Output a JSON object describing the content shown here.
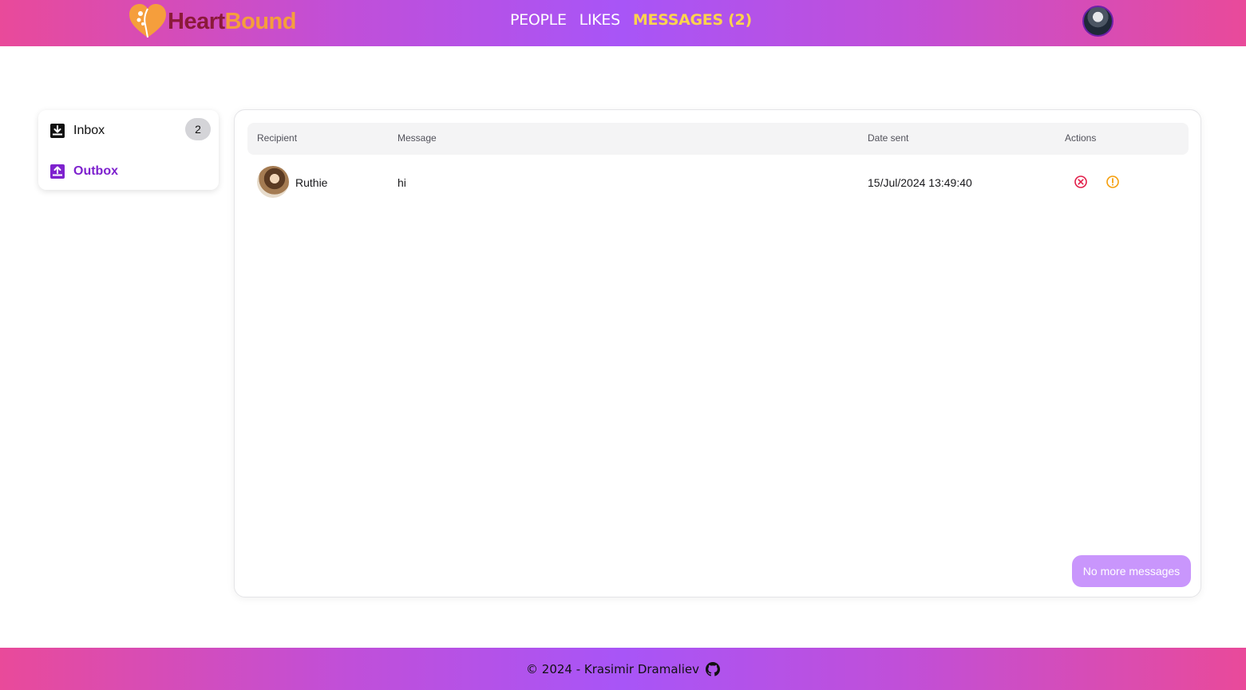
{
  "brand": {
    "part1": "Heart",
    "part2": "Bound",
    "icon": "heart-logo-icon"
  },
  "nav": {
    "links": [
      {
        "label": "PEOPLE"
      },
      {
        "label": "LIKES"
      },
      {
        "label": "MESSAGES (2)",
        "active": true
      }
    ],
    "avatar_icon": "user-avatar"
  },
  "sidebar": {
    "inbox": {
      "label": "Inbox",
      "count": "2",
      "icon": "inbox-down-icon"
    },
    "outbox": {
      "label": "Outbox",
      "icon": "outbox-up-icon",
      "active": true
    }
  },
  "table": {
    "headers": {
      "recipient": "Recipient",
      "message": "Message",
      "date": "Date sent",
      "actions": "Actions"
    },
    "rows": [
      {
        "recipient": "Ruthie",
        "message": "hi",
        "date": "15/Jul/2024 13:49:40"
      }
    ]
  },
  "load_more": {
    "label": "No more messages"
  },
  "footer": {
    "text": "© 2024 - Krasimir Dramaliev",
    "icon": "github-icon"
  },
  "colors": {
    "accent": "#a855f7",
    "active_nav": "#fcd34d",
    "outbox": "#7e22ce",
    "delete_action": "#e11d48",
    "report_action": "#f59e0b"
  }
}
